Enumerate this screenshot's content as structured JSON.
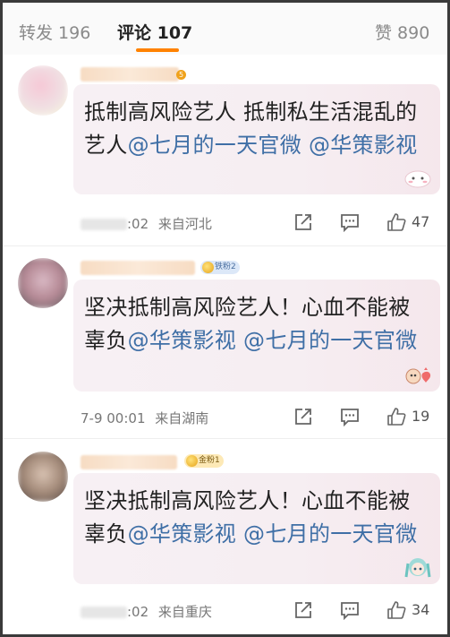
{
  "tabs": {
    "repost": "转发 196",
    "comments": "评论 107",
    "likes": "赞 890"
  },
  "comments": [
    {
      "body": "抵制高风险艺人 抵制私生活混乱的艺人",
      "mentions": [
        "@七月的一天官微",
        "@华策影视"
      ],
      "time_suffix": ":02",
      "location": "来自河北",
      "like_count": "47",
      "badge": ""
    },
    {
      "body": "坚决抵制高风险艺人！心血不能被辜负",
      "mentions": [
        "@华策影视",
        "@七月的一天官微"
      ],
      "time": "7-9 00:01",
      "location": "来自湖南",
      "like_count": "19",
      "badge": "铁粉2"
    },
    {
      "body": "坚决抵制高风险艺人！心血不能被辜负",
      "mentions": [
        "@华策影视",
        "@七月的一天官微"
      ],
      "time_suffix": ":02",
      "location": "来自重庆",
      "like_count": "34",
      "badge": "金粉1"
    }
  ],
  "icons": {
    "repost": "share-square-icon",
    "reply": "chat-bubble-icon",
    "like": "thumbs-up-icon"
  },
  "colors": {
    "accent": "#ff8200",
    "mention": "#3f6fa6",
    "bubble": "#f7f0f4"
  }
}
